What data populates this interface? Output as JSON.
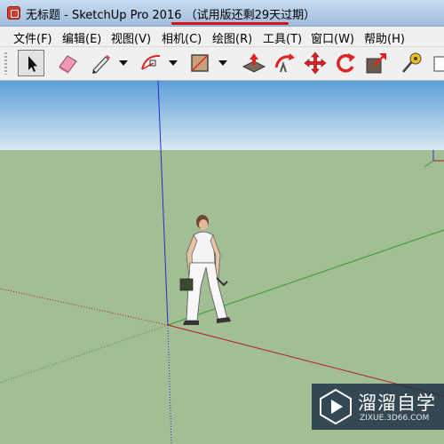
{
  "window": {
    "title": "无标题 - SketchUp Pro 2016 （试用版还剩29天过期）",
    "app_icon": "sketchup-logo-icon"
  },
  "menu": {
    "items": [
      "文件(F)",
      "编辑(E)",
      "视图(V)",
      "相机(C)",
      "绘图(R)",
      "工具(T)",
      "窗口(W)",
      "帮助(H)"
    ]
  },
  "toolbar": {
    "tools": [
      "select-arrow-icon",
      "eraser-icon",
      "pencil-line-icon",
      "dropdown-arrow-icon",
      "arc-icon",
      "dropdown-arrow-icon",
      "rectangle-icon",
      "dropdown-arrow-icon",
      "push-pull-icon",
      "follow-me-icon",
      "move-icon",
      "rotate-icon",
      "scale-icon",
      "tape-measure-icon"
    ],
    "active_tool": "select-arrow-icon"
  },
  "viewport": {
    "sky_color": "#9fc4e2",
    "ground_color": "#a3bd94",
    "axis_colors": {
      "red": "#b31a1a",
      "green": "#2e9e2e",
      "blue": "#2a2acc"
    },
    "model": "scale-figure-person"
  },
  "watermark": {
    "title": "溜溜自学",
    "url": "ZIXUE.3D66.COM"
  }
}
